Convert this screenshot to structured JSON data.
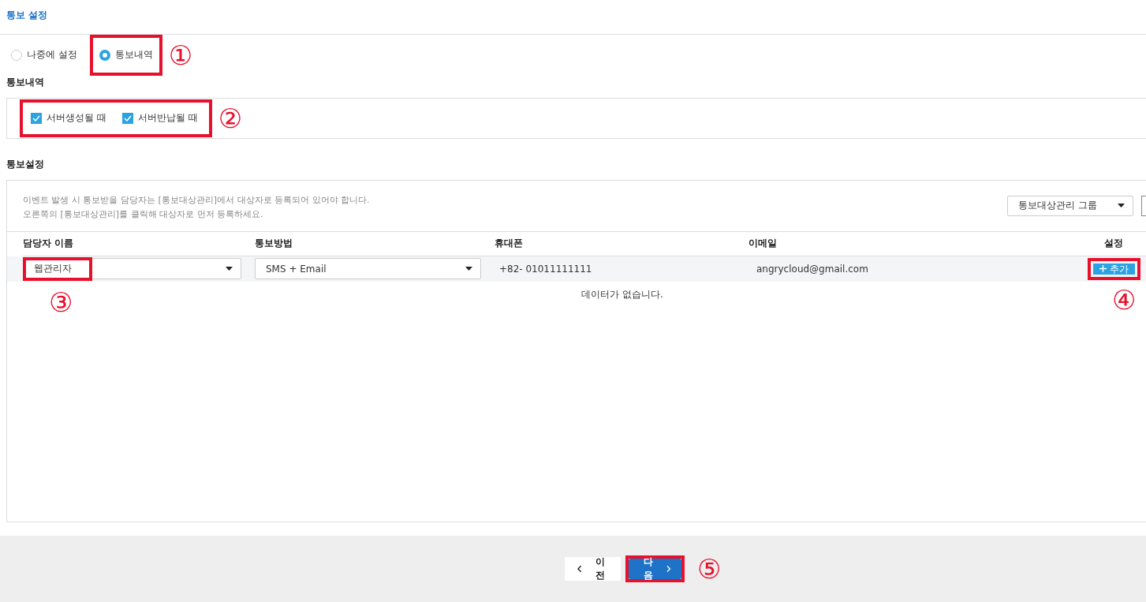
{
  "page_title": "통보 설정",
  "notify_mode": {
    "options": [
      {
        "label": "나중에 설정",
        "selected": false,
        "highlighted": false
      },
      {
        "label": "통보내역",
        "selected": true,
        "highlighted": true
      }
    ],
    "callout": "①"
  },
  "events": {
    "title": "통보내역",
    "highlighted": true,
    "callout": "②",
    "options": [
      {
        "label": "서버생성될 때",
        "checked": true
      },
      {
        "label": "서버반납될 때",
        "checked": true
      }
    ]
  },
  "settings": {
    "title": "통보설정",
    "notice": [
      "이벤트 발생 시 통보받을 담당자는 [통보대상관리]에서 대상자로 등록되어 있어야 합니다.",
      "오른쪽의 [통보대상관리]를 클릭해 대상자로 먼저 등록하세요."
    ],
    "group_select": {
      "value": "통보대상관리 그룹"
    },
    "table": {
      "columns": [
        "담당자 이름",
        "통보방법",
        "휴대폰",
        "이메일",
        "설정"
      ],
      "rows": [
        {
          "name": "웹관리자",
          "name_highlighted": true,
          "name_callout": "③",
          "method": "SMS + Email",
          "phone": "+82- 01011111111",
          "email": "angrycloud@gmail.com",
          "action": "추가",
          "action_highlighted": true,
          "action_callout": "④"
        }
      ],
      "empty_message": "데이터가 없습니다."
    }
  },
  "footer": {
    "prev": "이전",
    "next": "다음",
    "next_highlighted": true,
    "next_callout": "⑤"
  }
}
